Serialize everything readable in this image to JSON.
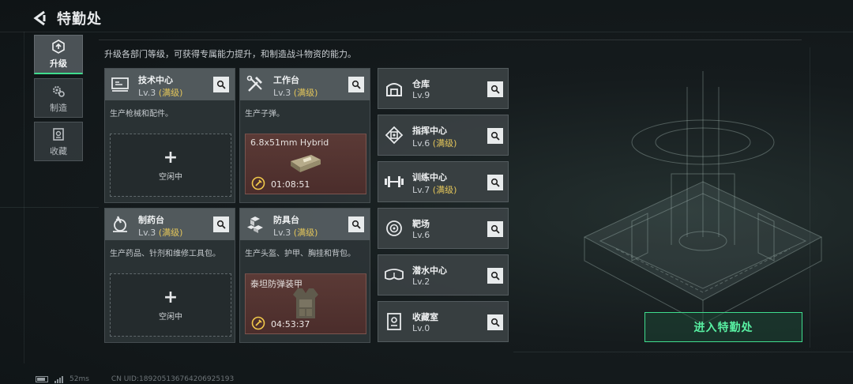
{
  "header": {
    "title": "特勤处"
  },
  "nav": {
    "items": [
      {
        "label": "升级",
        "icon": "upgrade-icon",
        "active": true
      },
      {
        "label": "制造",
        "icon": "gear-icon",
        "active": false
      },
      {
        "label": "收藏",
        "icon": "collection-icon",
        "active": false
      }
    ]
  },
  "description": "升级各部门等级，可获得专属能力提升，和制造战斗物资的能力。",
  "cards": [
    {
      "name": "技术中心",
      "level": "Lv.3",
      "maxed": "(满级)",
      "desc": "生产枪械和配件。",
      "slot": {
        "type": "idle",
        "plus": "+",
        "text": "空闲中"
      }
    },
    {
      "name": "工作台",
      "level": "Lv.3",
      "maxed": "(满级)",
      "desc": "生产子弹。",
      "slot": {
        "type": "craft",
        "item": "6.8x51mm Hybrid",
        "time": "01:08:51"
      }
    },
    {
      "name": "制药台",
      "level": "Lv.3",
      "maxed": "(满级)",
      "desc": "生产药品、针剂和维修工具包。",
      "slot": {
        "type": "idle",
        "plus": "+",
        "text": "空闲中"
      }
    },
    {
      "name": "防具台",
      "level": "Lv.3",
      "maxed": "(满级)",
      "desc": "生产头盔、护甲、胸挂和背包。",
      "slot": {
        "type": "craft",
        "item": "泰坦防弹装甲",
        "time": "04:53:37"
      }
    }
  ],
  "small_cards": [
    {
      "name": "仓库",
      "level": "Lv.9",
      "maxed": "",
      "icon": "warehouse-icon"
    },
    {
      "name": "指挥中心",
      "level": "Lv.6",
      "maxed": "(满级)",
      "icon": "command-center-icon"
    },
    {
      "name": "训练中心",
      "level": "Lv.7",
      "maxed": "(满级)",
      "icon": "dumbbell-icon"
    },
    {
      "name": "靶场",
      "level": "Lv.6",
      "maxed": "",
      "icon": "target-icon"
    },
    {
      "name": "潜水中心",
      "level": "Lv.2",
      "maxed": "",
      "icon": "diving-mask-icon"
    },
    {
      "name": "收藏室",
      "level": "Lv.0",
      "maxed": "",
      "icon": "collection-room-icon"
    }
  ],
  "enter_button": "进入特勤处",
  "footer": {
    "ping": "52ms",
    "uid": "CN UID:18920513676420692519​3"
  },
  "colors": {
    "accent_green": "#3fdd8e",
    "maxed_gold": "#e4c65a",
    "craft_bg": "#5b3a36"
  }
}
